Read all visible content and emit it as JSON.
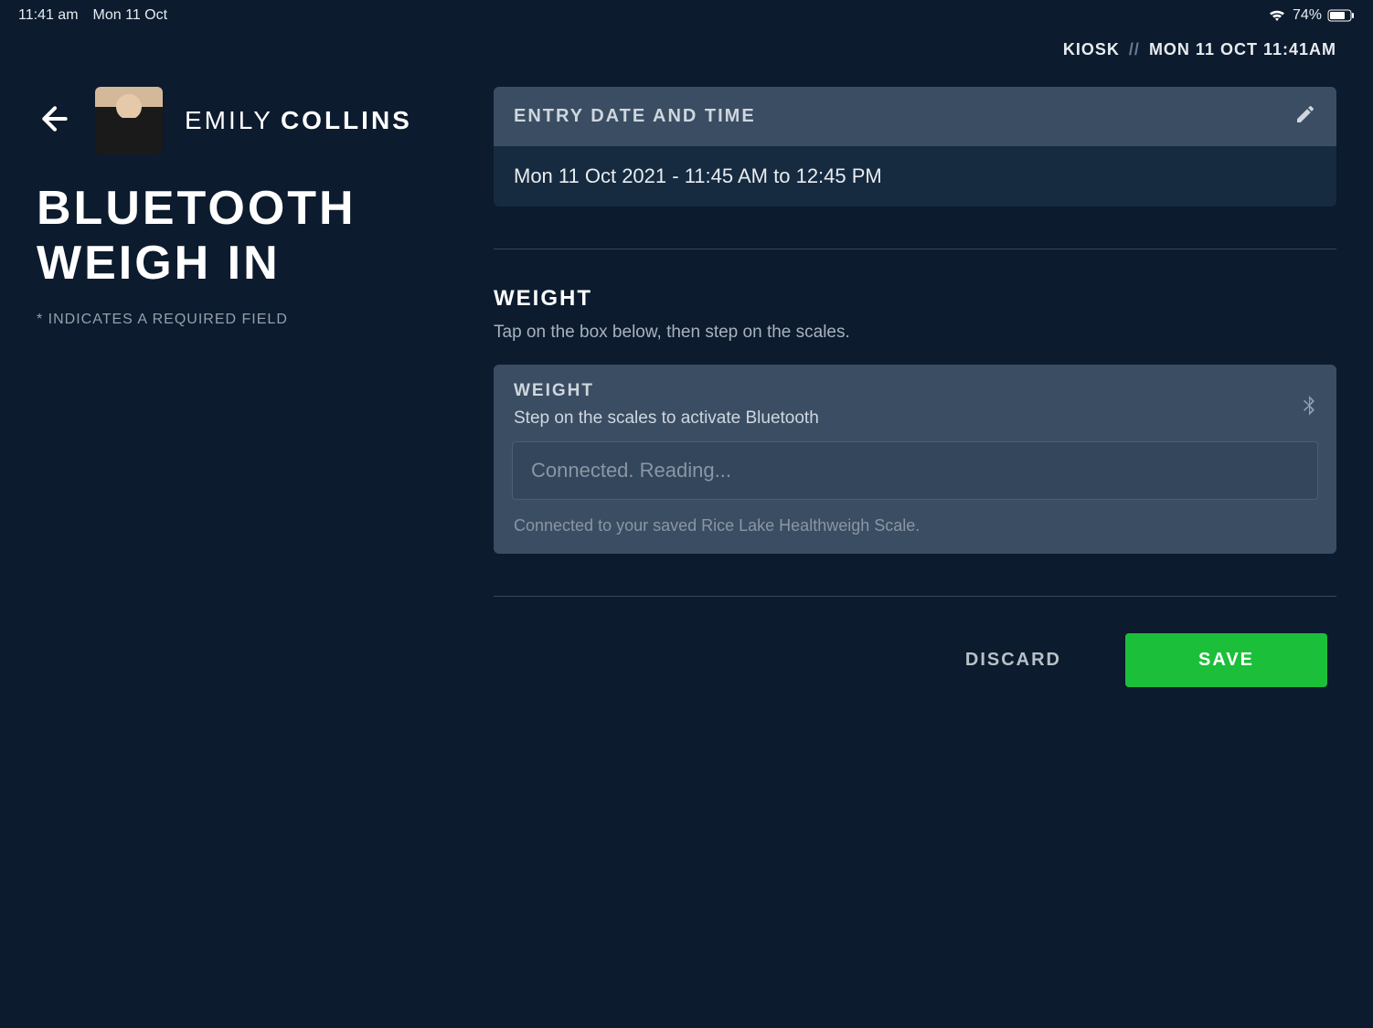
{
  "status_bar": {
    "time": "11:41 am",
    "date": "Mon 11 Oct",
    "battery": "74%"
  },
  "kiosk_bar": {
    "label": "KIOSK",
    "datetime": "MON 11 OCT 11:41AM"
  },
  "user": {
    "first_name": "EMILY",
    "last_name": "COLLINS"
  },
  "page": {
    "title": "BLUETOOTH WEIGH IN",
    "required_note": "* INDICATES A REQUIRED FIELD"
  },
  "entry_card": {
    "header": "ENTRY DATE AND TIME",
    "value": "Mon 11 Oct 2021 - 11:45 AM to 12:45 PM"
  },
  "weight_section": {
    "title": "WEIGHT",
    "subtitle": "Tap on the box below, then step on the scales.",
    "card_title": "WEIGHT",
    "card_sub": "Step on the scales to activate Bluetooth",
    "input_placeholder": "Connected. Reading...",
    "status": "Connected to your saved Rice Lake Healthweigh Scale."
  },
  "actions": {
    "discard": "DISCARD",
    "save": "SAVE"
  }
}
